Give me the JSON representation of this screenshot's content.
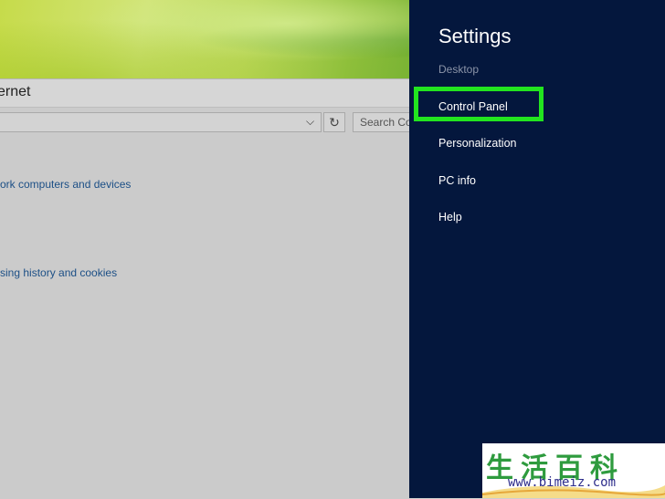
{
  "window": {
    "title_fragment": "ernet",
    "search_placeholder": "Search Co",
    "links": [
      "ork computers and devices",
      "sing history and cookies"
    ]
  },
  "settings": {
    "title": "Settings",
    "context": "Desktop",
    "items": [
      "Control Panel",
      "Personalization",
      "PC info",
      "Help"
    ],
    "highlight_color": "#22e51f",
    "panel_color": "#04173d"
  },
  "watermark": {
    "chars": "生活百科",
    "url": "www.bimeiz.com"
  }
}
